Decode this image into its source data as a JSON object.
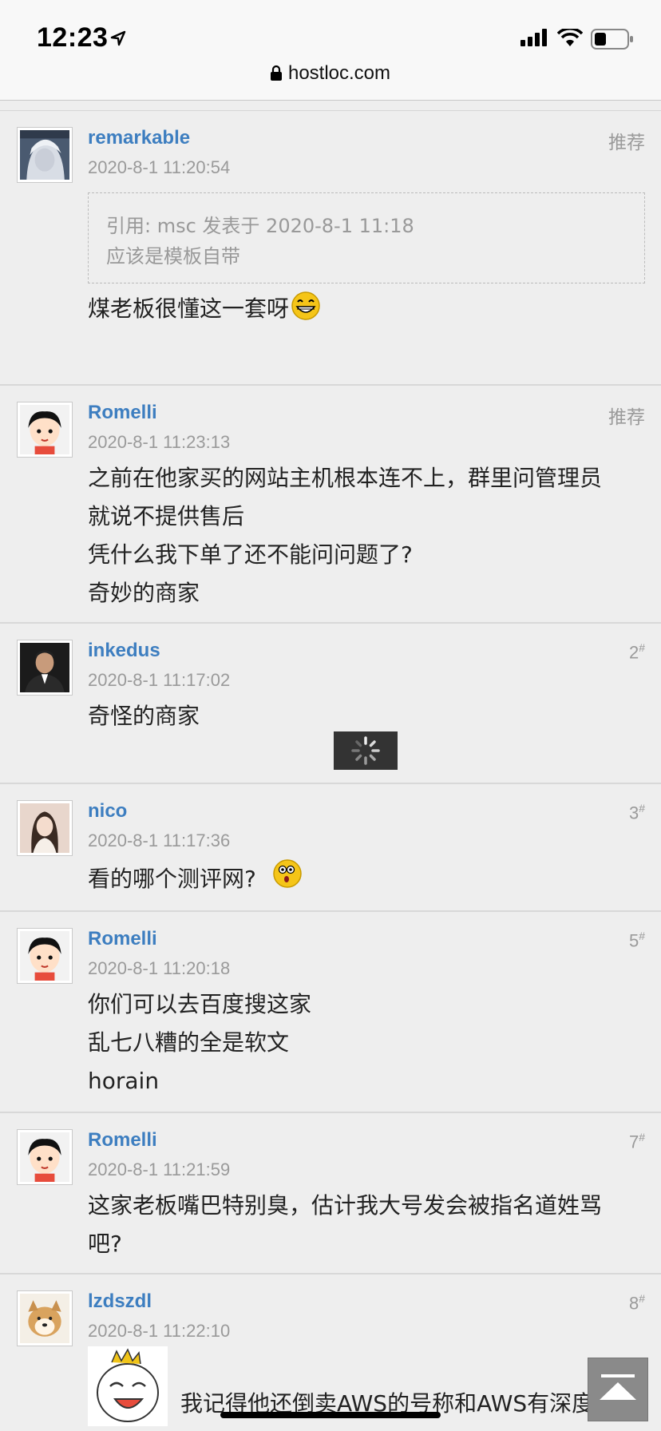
{
  "status_bar": {
    "time": "12:23"
  },
  "browser": {
    "url": "hostloc.com"
  },
  "posts": [
    {
      "author": "remarkable",
      "date": "2020-8-1 11:20:54",
      "tag": "推荐",
      "quote": {
        "line1": "引用: msc 发表于 2020-8-1 11:18",
        "line2": "应该是模板自带"
      },
      "lines": [
        "煤老板很懂这一套呀"
      ]
    },
    {
      "author": "Romelli",
      "date": "2020-8-1 11:23:13",
      "tag": "推荐",
      "lines": [
        "之前在他家买的网站主机根本连不上，群里问管理员",
        "就说不提供售后",
        "凭什么我下单了还不能问问题了?",
        "奇妙的商家"
      ]
    },
    {
      "author": "inkedus",
      "date": "2020-8-1 11:17:02",
      "floor": "2",
      "lines": [
        "奇怪的商家"
      ]
    },
    {
      "author": "nico",
      "date": "2020-8-1 11:17:36",
      "floor": "3",
      "lines": [
        "看的哪个测评网?"
      ]
    },
    {
      "author": "Romelli",
      "date": "2020-8-1 11:20:18",
      "floor": "5",
      "lines": [
        "你们可以去百度搜这家",
        "乱七八糟的全是软文",
        "horain"
      ]
    },
    {
      "author": "Romelli",
      "date": "2020-8-1 11:21:59",
      "floor": "7",
      "lines": [
        "这家老板嘴巴特别臭，估计我大号发会被指名道姓骂",
        "吧?"
      ]
    },
    {
      "author": "lzdszdl",
      "date": "2020-8-1 11:22:10",
      "floor": "8",
      "lines": [
        "我记得他还倒卖AWS的号称和AWS有深度"
      ]
    }
  ],
  "floor_mark": "#"
}
